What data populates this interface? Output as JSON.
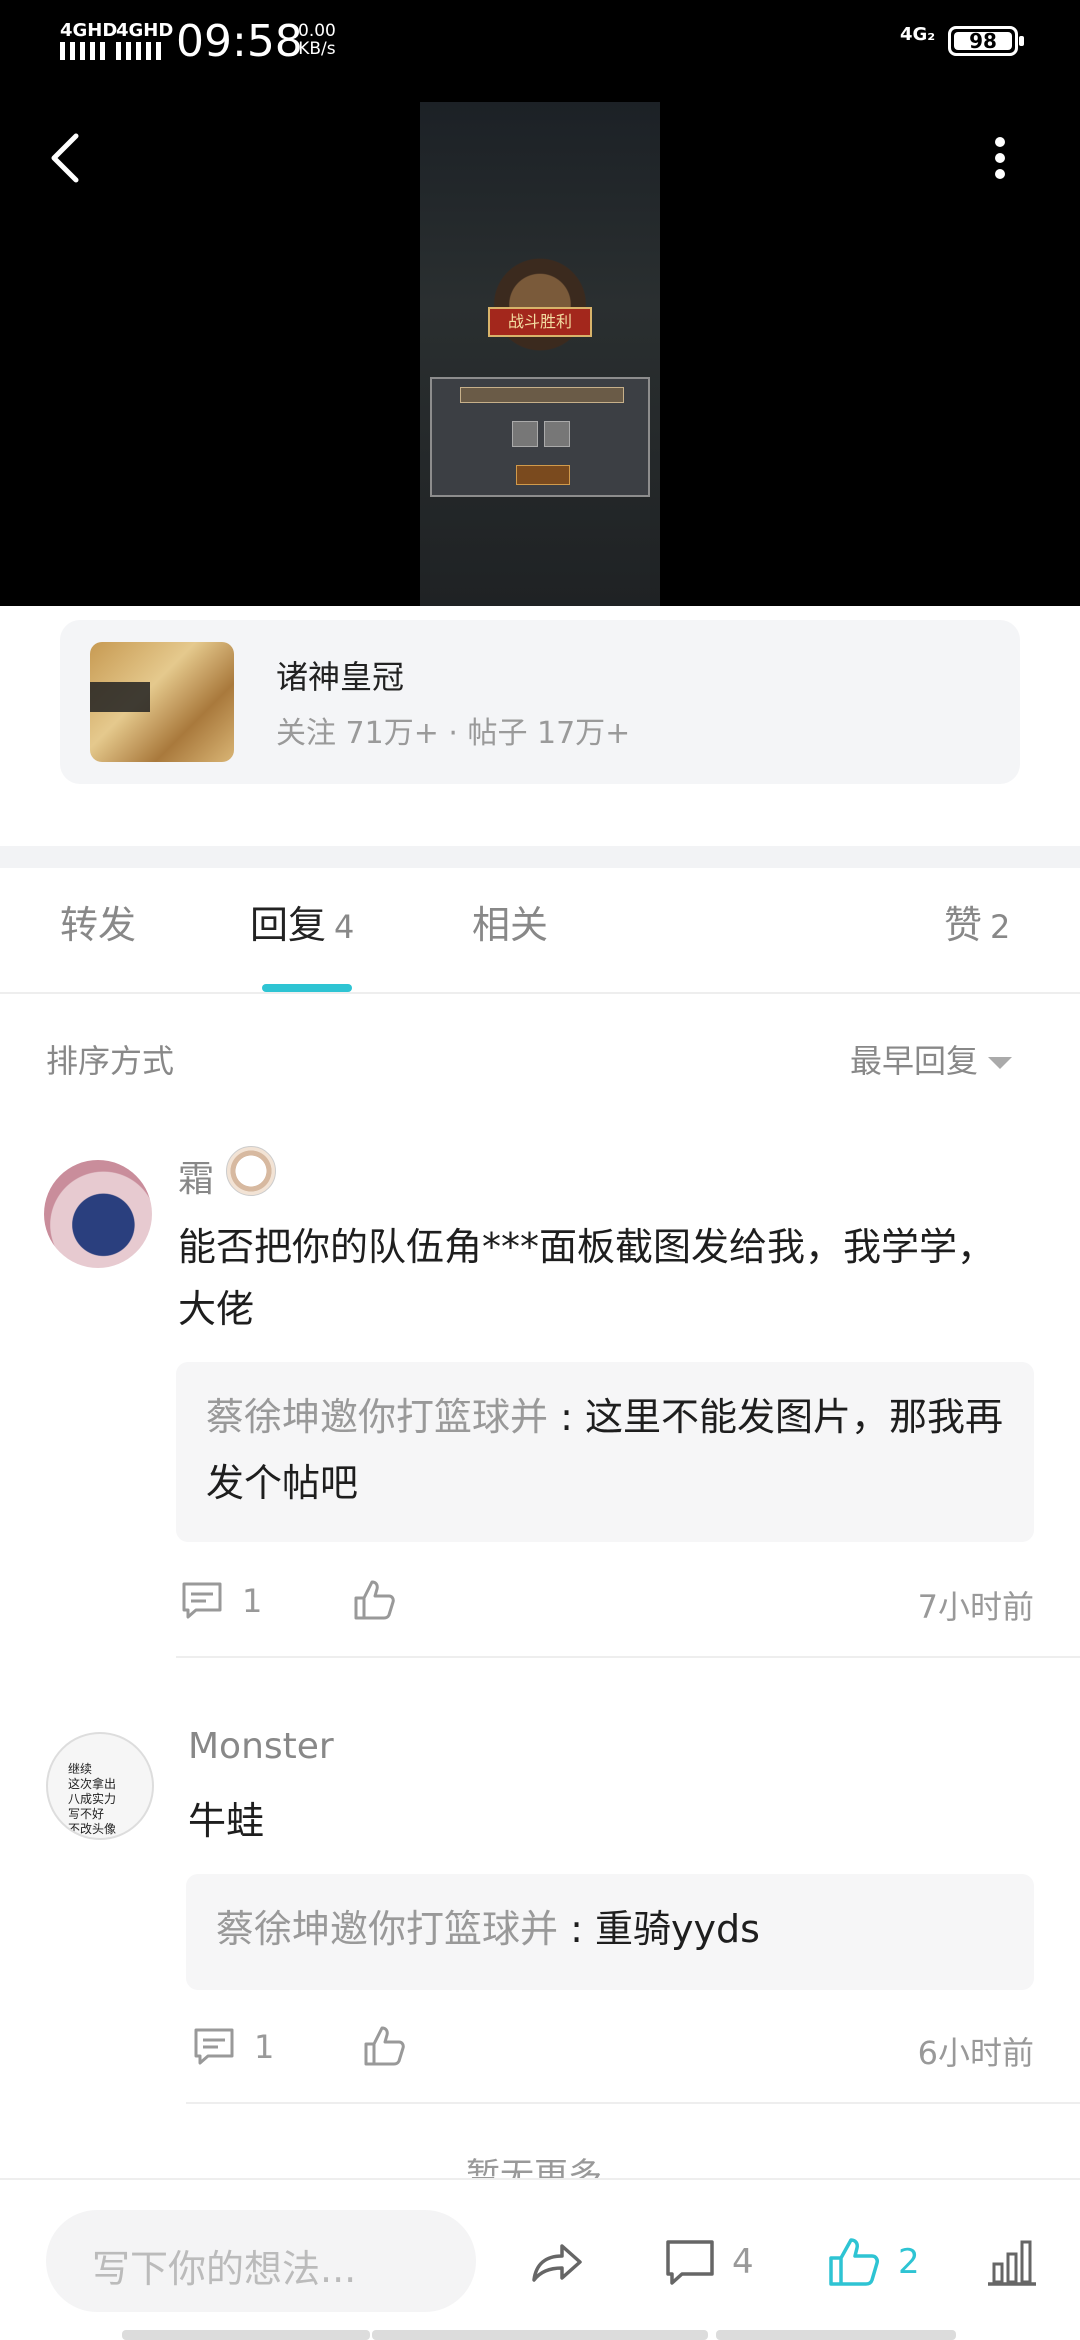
{
  "status_bar": {
    "sig1": "4GHD",
    "sig2": "4GHD",
    "time": "09:58",
    "speed_value": "0.00",
    "speed_unit": "KB/s",
    "network": "4G₂",
    "battery": "98"
  },
  "header": {
    "back_icon": "back-chevron",
    "more_icon": "more-vertical",
    "image_banner": "战斗胜利"
  },
  "forum": {
    "name": "诸神皇冠",
    "stats": "关注 71万+  ·  帖子 17万+"
  },
  "tabs": [
    {
      "label": "转发",
      "count": ""
    },
    {
      "label": "回复",
      "count": "4"
    },
    {
      "label": "相关",
      "count": ""
    },
    {
      "label": "赞",
      "count": "2"
    }
  ],
  "sort": {
    "label": "排序方式",
    "value": "最早回复"
  },
  "comments": [
    {
      "user": "霜",
      "text": "能否把你的队伍角***面板截图发给我，我学学，大佬",
      "reply_user": "蔡徐坤邀你打篮球并",
      "reply_text": "这里不能发图片，那我再发个帖吧",
      "comment_count": "1",
      "time": "7小时前"
    },
    {
      "user": "Monster",
      "avatar_text": [
        "继续",
        "这次拿出",
        "八成实力",
        "写不好",
        "不改头像"
      ],
      "text": "牛蛙",
      "reply_user": "蔡徐坤邀你打篮球并",
      "reply_text": "重骑yyds",
      "comment_count": "1",
      "time": "6小时前"
    }
  ],
  "more_hint": "暂无更多",
  "bottom_bar": {
    "input_placeholder": "写下你的想法...",
    "comment_count": "4",
    "like_count": "2",
    "accent_color": "#2ec4d3"
  }
}
